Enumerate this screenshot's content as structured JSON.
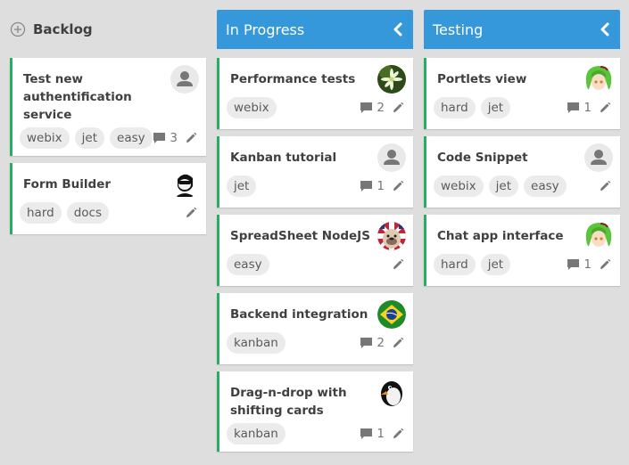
{
  "colors": {
    "background": "#dedede",
    "header_blue": "#3498db",
    "card_accent": "#27ae60",
    "tag_bg": "#ebebeb"
  },
  "columns": [
    {
      "title": "Backlog",
      "header_icon": "add-icon",
      "style": "plain",
      "cards": [
        {
          "title": "Test new authentification service",
          "avatar": "default-user",
          "tags": [
            "webix",
            "jet",
            "easy"
          ],
          "comments": "3"
        },
        {
          "title": "Form Builder",
          "avatar": "sunglasses-man",
          "tags": [
            "hard",
            "docs"
          ],
          "comments": null
        }
      ]
    },
    {
      "title": "In Progress",
      "header_icon": "collapse-icon",
      "style": "blue",
      "cards": [
        {
          "title": "Performance tests",
          "avatar": "flower",
          "tags": [
            "webix"
          ],
          "comments": "2"
        },
        {
          "title": "Kanban tutorial",
          "avatar": "default-user",
          "tags": [
            "jet"
          ],
          "comments": "1"
        },
        {
          "title": "SpreadSheet NodeJS",
          "avatar": "bulldog",
          "tags": [
            "easy"
          ],
          "comments": null
        },
        {
          "title": "Backend integration",
          "avatar": "brazil-flag",
          "tags": [
            "kanban"
          ],
          "comments": "2"
        },
        {
          "title": "Drag-n-drop with shifting cards",
          "avatar": "penguin",
          "tags": [
            "kanban"
          ],
          "comments": "1"
        }
      ]
    },
    {
      "title": "Testing",
      "header_icon": "collapse-icon",
      "style": "blue",
      "cards": [
        {
          "title": "Portlets view",
          "avatar": "anime-girl",
          "tags": [
            "hard",
            "jet"
          ],
          "comments": "1"
        },
        {
          "title": "Code Snippet",
          "avatar": "default-user",
          "tags": [
            "webix",
            "jet",
            "easy"
          ],
          "comments": null
        },
        {
          "title": "Chat app interface",
          "avatar": "anime-girl",
          "tags": [
            "hard",
            "jet"
          ],
          "comments": "1"
        }
      ]
    }
  ]
}
